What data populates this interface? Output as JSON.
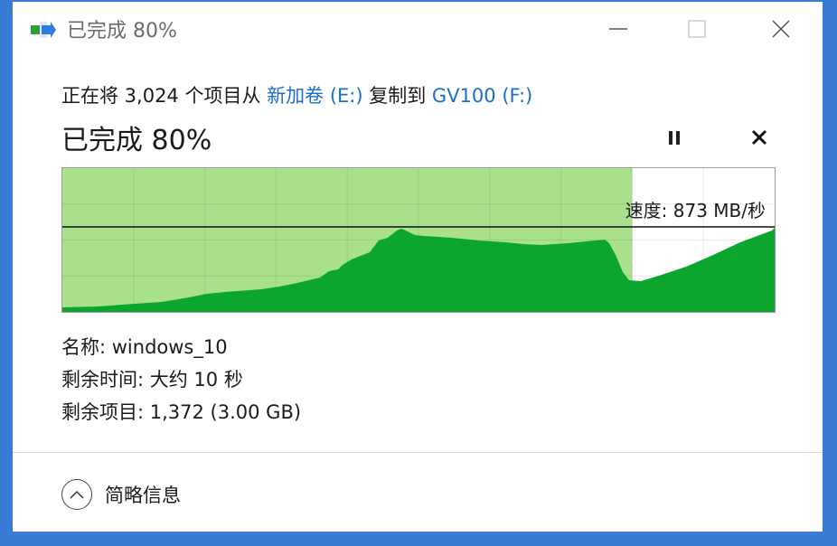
{
  "window": {
    "title": "已完成 80%"
  },
  "copy": {
    "prefix": "正在将 3,024 个项目从 ",
    "source": "新加卷 (E:)",
    "middle": " 复制到 ",
    "destination": "GV100 (F:)"
  },
  "progress": {
    "heading": "已完成 80%",
    "percent": 80,
    "speed_label": "速度: 873 MB/秒"
  },
  "details": {
    "name": "名称: windows_10",
    "time_remaining": "剩余时间: 大约 10 秒",
    "items_remaining": "剩余项目: 1,372 (3.00 GB)"
  },
  "footer": {
    "toggle_label": "简略信息"
  },
  "colors": {
    "progress_fill": "#a8e08c",
    "throughput_area": "#0ca62e",
    "link": "#1a6fc9"
  },
  "icons": {
    "app": "copy-transfer-icon",
    "pause": "pause-icon",
    "cancel": "close-icon",
    "toggle": "chevron-up-icon"
  }
}
